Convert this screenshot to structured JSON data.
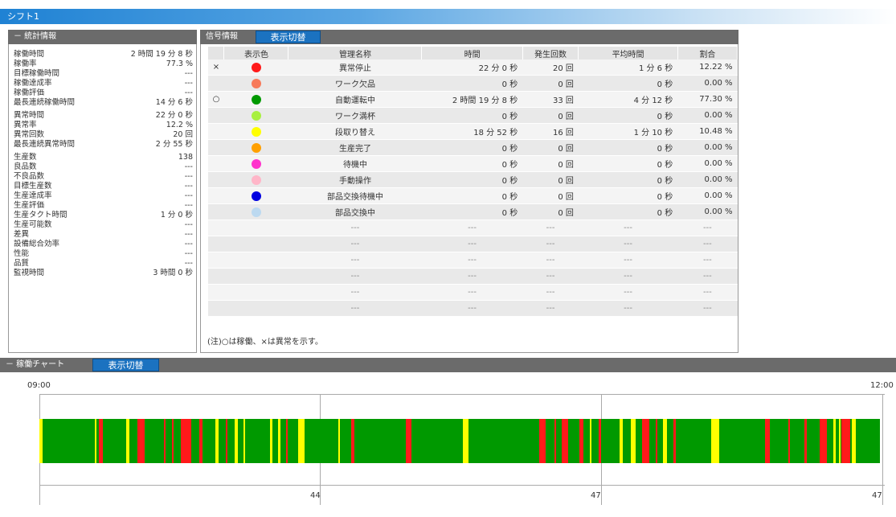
{
  "shift": {
    "title": "シフト1"
  },
  "stats": {
    "header": "－ 統計情報",
    "rows": [
      {
        "label": "稼働時間",
        "value": "2 時間 19 分 8 秒"
      },
      {
        "label": "稼働率",
        "value": "77.3 %"
      },
      {
        "label": "目標稼働時間",
        "value": "---"
      },
      {
        "label": "稼働達成率",
        "value": "---"
      },
      {
        "label": "稼働評価",
        "value": "---"
      },
      {
        "label": "最長連続稼働時間",
        "value": "14 分 6 秒"
      },
      {
        "label": "異常時間",
        "value": "22 分 0 秒"
      },
      {
        "label": "異常率",
        "value": "12.2 %"
      },
      {
        "label": "異常回数",
        "value": "20 回"
      },
      {
        "label": "最長連続異常時間",
        "value": "2 分 55 秒"
      },
      {
        "label": "生産数",
        "value": "138"
      },
      {
        "label": "良品数",
        "value": "---"
      },
      {
        "label": "不良品数",
        "value": "---"
      },
      {
        "label": "目標生産数",
        "value": "---"
      },
      {
        "label": "生産達成率",
        "value": "---"
      },
      {
        "label": "生産評価",
        "value": "---"
      },
      {
        "label": "生産タクト時間",
        "value": "1 分 0 秒"
      },
      {
        "label": "生産可能数",
        "value": "---"
      },
      {
        "label": "差異",
        "value": "---"
      },
      {
        "label": "設備総合効率",
        "value": "---"
      },
      {
        "label": "性能",
        "value": "---"
      },
      {
        "label": "品質",
        "value": "---"
      },
      {
        "label": "監視時間",
        "value": "3 時間 0 秒"
      }
    ]
  },
  "signal": {
    "header": "信号情報",
    "toggle_label": "表示切替",
    "columns": [
      "表示色",
      "管理名称",
      "時間",
      "発生回数",
      "平均時間",
      "割合"
    ],
    "rows": [
      {
        "mark": "×",
        "color": "#ff1a1a",
        "name": "異常停止",
        "time": "22 分 0 秒",
        "count": "20 回",
        "avg": "1 分 6 秒",
        "ratio": "12.22 %"
      },
      {
        "mark": "",
        "color": "#f77a5a",
        "name": "ワーク欠品",
        "time": "0 秒",
        "count": "0 回",
        "avg": "0 秒",
        "ratio": "0.00 %"
      },
      {
        "mark": "○",
        "color": "#009900",
        "name": "自動運転中",
        "time": "2 時間 19 分 8 秒",
        "count": "33 回",
        "avg": "4 分 12 秒",
        "ratio": "77.30 %"
      },
      {
        "mark": "",
        "color": "#a8f040",
        "name": "ワーク満杯",
        "time": "0 秒",
        "count": "0 回",
        "avg": "0 秒",
        "ratio": "0.00 %"
      },
      {
        "mark": "",
        "color": "#ffff00",
        "name": "段取り替え",
        "time": "18 分 52 秒",
        "count": "16 回",
        "avg": "1 分 10 秒",
        "ratio": "10.48 %"
      },
      {
        "mark": "",
        "color": "#ffa000",
        "name": "生産完了",
        "time": "0 秒",
        "count": "0 回",
        "avg": "0 秒",
        "ratio": "0.00 %"
      },
      {
        "mark": "",
        "color": "#ff33cc",
        "name": "待機中",
        "time": "0 秒",
        "count": "0 回",
        "avg": "0 秒",
        "ratio": "0.00 %"
      },
      {
        "mark": "",
        "color": "#ffb6c8",
        "name": "手動操作",
        "time": "0 秒",
        "count": "0 回",
        "avg": "0 秒",
        "ratio": "0.00 %"
      },
      {
        "mark": "",
        "color": "#0000e0",
        "name": "部品交換待機中",
        "time": "0 秒",
        "count": "0 回",
        "avg": "0 秒",
        "ratio": "0.00 %"
      },
      {
        "mark": "",
        "color": "#bcd9f0",
        "name": "部品交換中",
        "time": "0 秒",
        "count": "0 回",
        "avg": "0 秒",
        "ratio": "0.00 %"
      }
    ],
    "empty_value": "---",
    "note": "(注)○は稼働、×は異常を示す。"
  },
  "chart": {
    "header": "－ 稼働チャート",
    "toggle_label": "表示切替",
    "start_label": "09:00",
    "end_label": "12:00",
    "counts": [
      "44",
      "47",
      "47"
    ],
    "colors": {
      "run": "#009900",
      "alarm": "#ff1a1a",
      "setup": "#ffff00"
    },
    "timeline_minutes": 180,
    "events": [
      {
        "start": 0.0,
        "end": 0.6,
        "state": "setup"
      },
      {
        "start": 11.8,
        "end": 12.2,
        "state": "setup"
      },
      {
        "start": 12.8,
        "end": 13.6,
        "state": "alarm"
      },
      {
        "start": 18.5,
        "end": 19.2,
        "state": "setup"
      },
      {
        "start": 20.9,
        "end": 22.5,
        "state": "alarm"
      },
      {
        "start": 26.7,
        "end": 27.1,
        "state": "alarm"
      },
      {
        "start": 28.3,
        "end": 28.8,
        "state": "alarm"
      },
      {
        "start": 30.2,
        "end": 32.5,
        "state": "alarm"
      },
      {
        "start": 34.3,
        "end": 35.0,
        "state": "alarm"
      },
      {
        "start": 37.6,
        "end": 38.3,
        "state": "setup"
      },
      {
        "start": 40.0,
        "end": 40.3,
        "state": "alarm"
      },
      {
        "start": 41.8,
        "end": 42.6,
        "state": "setup"
      },
      {
        "start": 43.7,
        "end": 44.1,
        "state": "setup"
      },
      {
        "start": 49.3,
        "end": 49.9,
        "state": "setup"
      },
      {
        "start": 51.1,
        "end": 51.6,
        "state": "setup"
      },
      {
        "start": 52.8,
        "end": 53.2,
        "state": "alarm"
      },
      {
        "start": 55.4,
        "end": 56.8,
        "state": "setup"
      },
      {
        "start": 64.0,
        "end": 64.2,
        "state": "setup"
      },
      {
        "start": 66.8,
        "end": 67.4,
        "state": "alarm"
      },
      {
        "start": 78.5,
        "end": 79.7,
        "state": "alarm"
      },
      {
        "start": 90.6,
        "end": 91.8,
        "state": "setup"
      },
      {
        "start": 107.1,
        "end": 108.5,
        "state": "alarm"
      },
      {
        "start": 110.3,
        "end": 110.7,
        "state": "alarm"
      },
      {
        "start": 111.9,
        "end": 113.2,
        "state": "alarm"
      },
      {
        "start": 115.7,
        "end": 116.5,
        "state": "alarm"
      },
      {
        "start": 117.8,
        "end": 118.3,
        "state": "setup"
      },
      {
        "start": 119.8,
        "end": 120.3,
        "state": "alarm"
      },
      {
        "start": 124.2,
        "end": 125.0,
        "state": "setup"
      },
      {
        "start": 126.6,
        "end": 127.7,
        "state": "setup"
      },
      {
        "start": 129.0,
        "end": 130.7,
        "state": "alarm"
      },
      {
        "start": 131.9,
        "end": 132.4,
        "state": "alarm"
      },
      {
        "start": 133.6,
        "end": 134.4,
        "state": "setup"
      },
      {
        "start": 135.7,
        "end": 136.3,
        "state": "alarm"
      },
      {
        "start": 143.8,
        "end": 145.6,
        "state": "setup"
      },
      {
        "start": 155.3,
        "end": 156.4,
        "state": "alarm"
      },
      {
        "start": 160.3,
        "end": 160.7,
        "state": "alarm"
      },
      {
        "start": 163.8,
        "end": 164.3,
        "state": "alarm"
      },
      {
        "start": 167.1,
        "end": 168.7,
        "state": "alarm"
      },
      {
        "start": 170.0,
        "end": 170.5,
        "state": "setup"
      },
      {
        "start": 171.2,
        "end": 171.6,
        "state": "setup"
      },
      {
        "start": 171.8,
        "end": 173.7,
        "state": "alarm"
      },
      {
        "start": 174.0,
        "end": 174.8,
        "state": "setup"
      }
    ]
  }
}
